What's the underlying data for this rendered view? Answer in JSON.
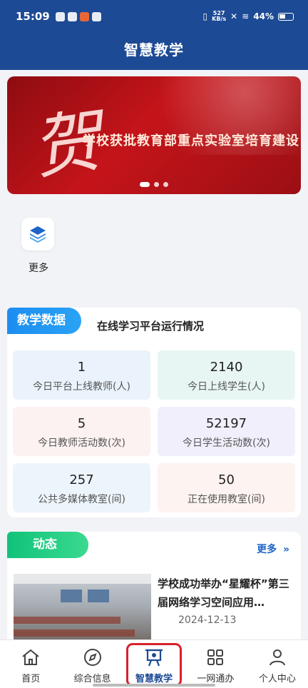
{
  "status_bar": {
    "time": "15:09",
    "net_speed_value": "527",
    "net_speed_unit": "KB/s",
    "battery": "44%"
  },
  "app": {
    "title": "智慧教学"
  },
  "banner": {
    "calligraphy": "贺",
    "headline": "学校获批教育部重点实验室培育建设",
    "slide_count": 3,
    "active_slide": 1
  },
  "quick": {
    "more_label": "更多",
    "more_icon": "layers-icon"
  },
  "teaching_data": {
    "tag": "教学数据",
    "subtitle": "在线学习平台运行情况",
    "stats": [
      {
        "value": "1",
        "label": "今日平台上线教师(人)"
      },
      {
        "value": "2140",
        "label": "今日上线学生(人)"
      },
      {
        "value": "5",
        "label": "今日教师活动数(次)"
      },
      {
        "value": "52197",
        "label": "今日学生活动数(次)"
      },
      {
        "value": "257",
        "label": "公共多媒体教室(间)"
      },
      {
        "value": "50",
        "label": "正在使用教室(间)"
      }
    ]
  },
  "news": {
    "tag": "动态",
    "more": "更多",
    "items": [
      {
        "title": "学校成功举办“星耀杯”第三届网络学习空间应用…",
        "date": "2024-12-13"
      }
    ]
  },
  "tabbar": {
    "items": [
      {
        "label": "首页",
        "icon": "home-icon"
      },
      {
        "label": "综合信息",
        "icon": "compass-icon"
      },
      {
        "label": "智慧教学",
        "icon": "presentation-board-icon",
        "active": true
      },
      {
        "label": "一网通办",
        "icon": "grid-apps-icon"
      },
      {
        "label": "个人中心",
        "icon": "person-icon"
      }
    ]
  },
  "colors": {
    "primary": "#1d4a94",
    "tag_blue": "#1c8df0",
    "tag_green": "#10c37a",
    "highlight_red": "#d9202b"
  }
}
